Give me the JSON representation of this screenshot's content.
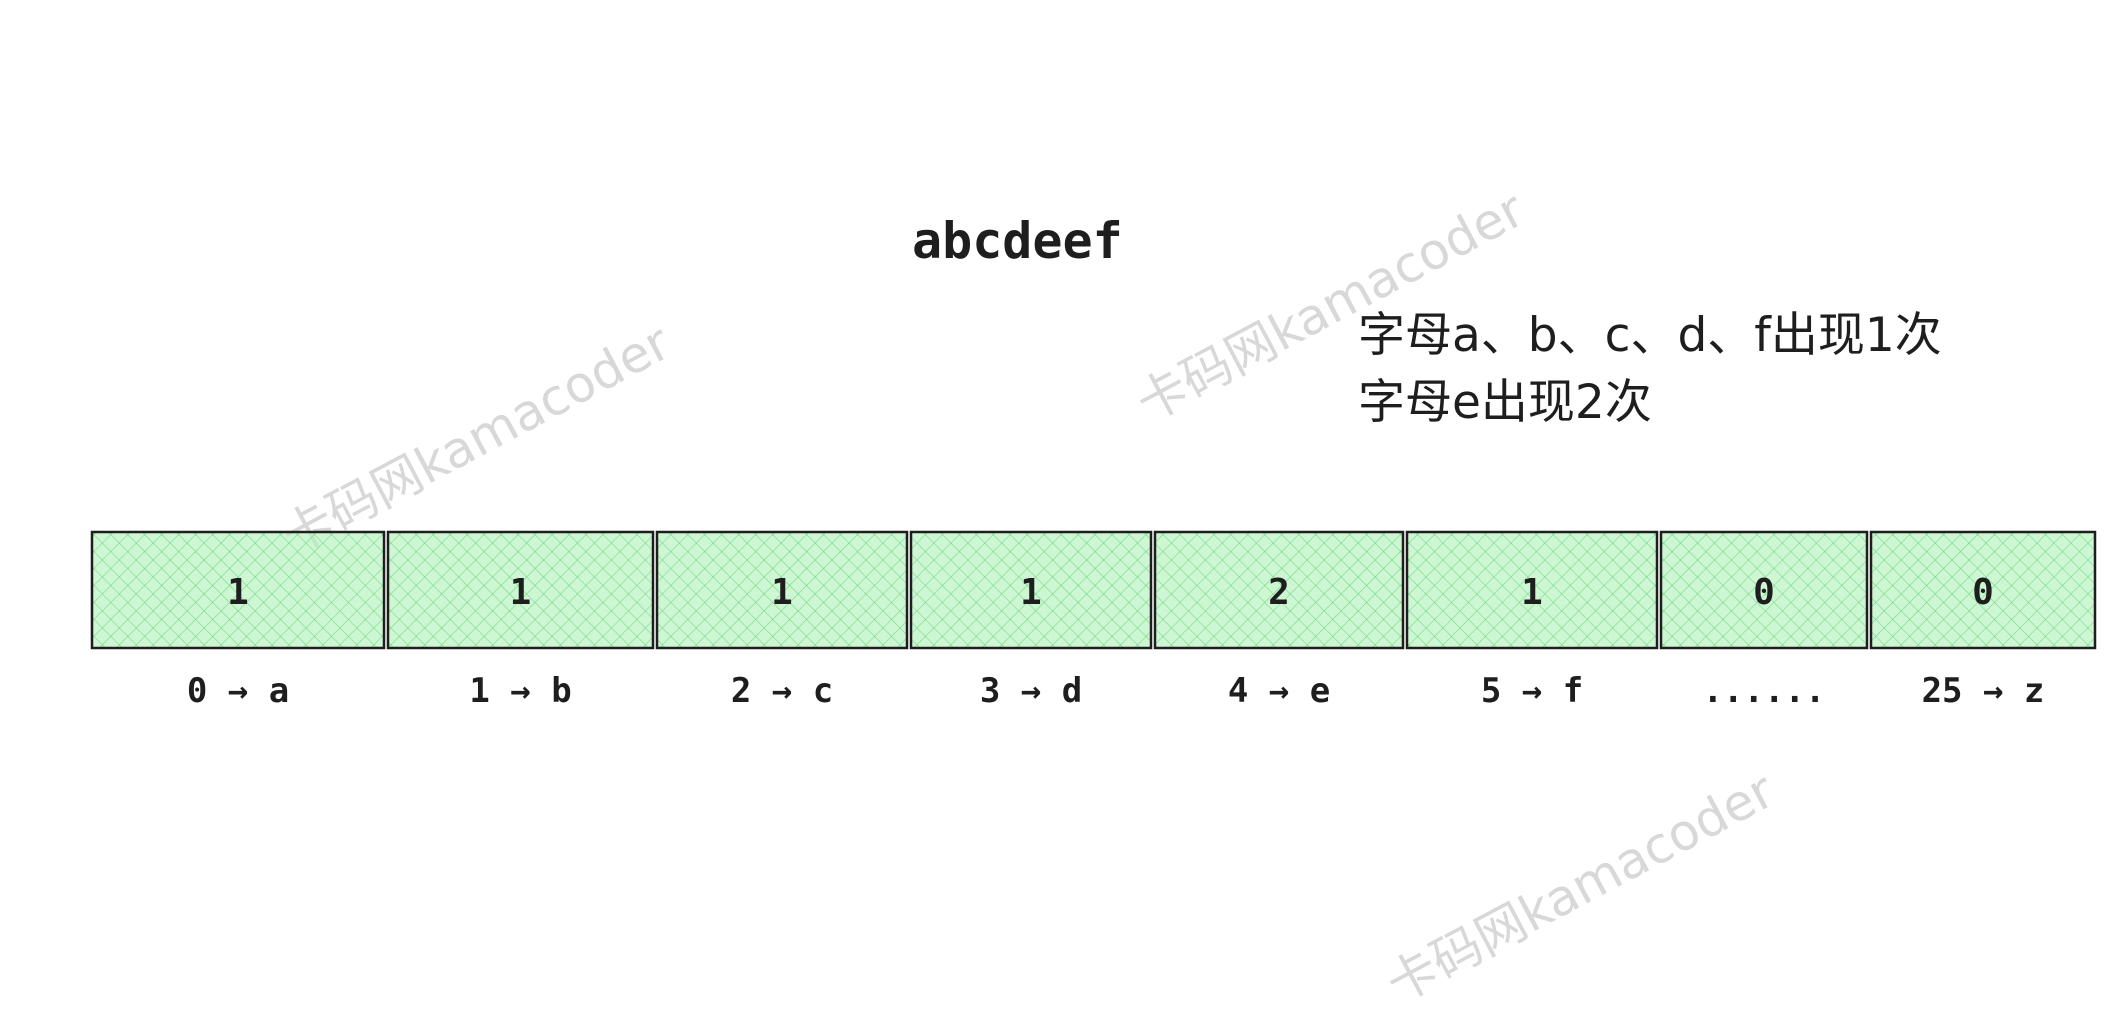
{
  "title": "abcdeef",
  "notes": [
    "字母a、b、c、d、f出现1次",
    "字母e出现2次"
  ],
  "watermark": "卡码网kamacoder",
  "colors": {
    "cell_fill": "#b2f2bb",
    "cell_hatch": "#40c057",
    "stroke": "#1e1e1e",
    "watermark": "#d8d8d8"
  },
  "chart_data": {
    "type": "table",
    "cells": [
      {
        "value": "1",
        "label": "0 → a"
      },
      {
        "value": "1",
        "label": "1 → b"
      },
      {
        "value": "1",
        "label": "2 → c"
      },
      {
        "value": "1",
        "label": "3 → d"
      },
      {
        "value": "2",
        "label": "4 → e"
      },
      {
        "value": "1",
        "label": "5 → f"
      },
      {
        "value": "0",
        "label": "......"
      },
      {
        "value": "0",
        "label": "25 → z"
      }
    ]
  }
}
